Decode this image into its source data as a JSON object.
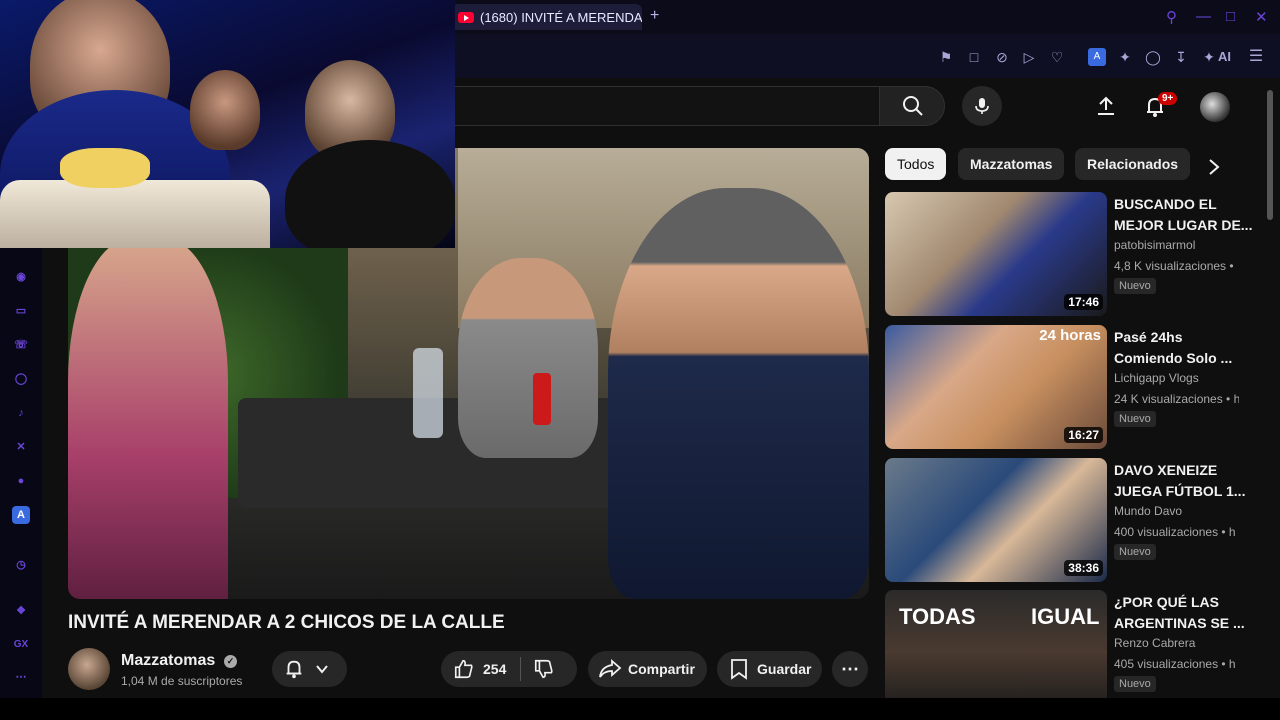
{
  "browser": {
    "tab_title": "(1680) INVITÉ A MERENDA",
    "new_tab": "+",
    "ai_label": "AI"
  },
  "header": {
    "notification_count": "9+"
  },
  "video": {
    "title": "INVITÉ A MERENDAR A 2 CHICOS DE LA CALLE",
    "channel": "Mazzatomas",
    "subscribers": "1,04 M de suscriptores",
    "likes": "254",
    "share_label": "Compartir",
    "save_label": "Guardar"
  },
  "chips": [
    "Todos",
    "Mazzatomas",
    "Relacionados"
  ],
  "recommendations": [
    {
      "title": "BUSCANDO EL MEJOR LUGAR DE...",
      "channel": "patobisimarmol",
      "views": "4,8 K visualizaciones •",
      "badge": "Nuevo",
      "duration": "17:46"
    },
    {
      "title": "Pasé 24hs Comiendo Solo ...",
      "channel": "Lichigapp Vlogs",
      "views": "24 K visualizaciones • h",
      "badge": "Nuevo",
      "duration": "16:27",
      "overlay": "24 horas"
    },
    {
      "title": "DAVO XENEIZE JUEGA FÚTBOL 1...",
      "channel": "Mundo Davo",
      "views": "400 visualizaciones • h",
      "badge": "Nuevo",
      "duration": "38:36"
    },
    {
      "title": "¿POR QUÉ LAS ARGENTINAS SE ...",
      "channel": "Renzo Cabrera",
      "views": "405 visualizaciones • h",
      "badge": "Nuevo",
      "overlay_left": "TODAS",
      "overlay_right": "IGUAL"
    }
  ],
  "sidebar": {
    "gx_label": "GX"
  },
  "colors": {
    "accent_purple": "#6a45d8",
    "yt_red": "#ff0033",
    "background": "#0f0f0f"
  }
}
